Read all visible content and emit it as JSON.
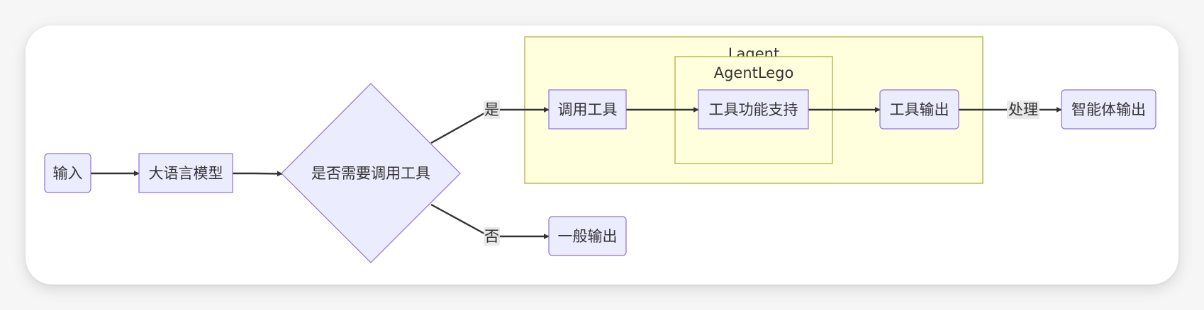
{
  "clusters": {
    "lagent": "Lagent",
    "agentlego": "AgentLego"
  },
  "nodes": {
    "input": "输入",
    "llm": "大语言模型",
    "decision": "是否需要调用工具",
    "call_tool": "调用工具",
    "tool_support": "工具功能支持",
    "tool_output": "工具输出",
    "agent_output": "智能体输出",
    "general_output": "一般输出"
  },
  "edge_labels": {
    "yes": "是",
    "no": "否",
    "process": "处理"
  },
  "colors": {
    "node_fill": "#ECECFF",
    "node_stroke": "#9370DB",
    "cluster_fill": "#ffffde",
    "cluster_stroke": "#aaaa33",
    "edge": "#333333"
  }
}
